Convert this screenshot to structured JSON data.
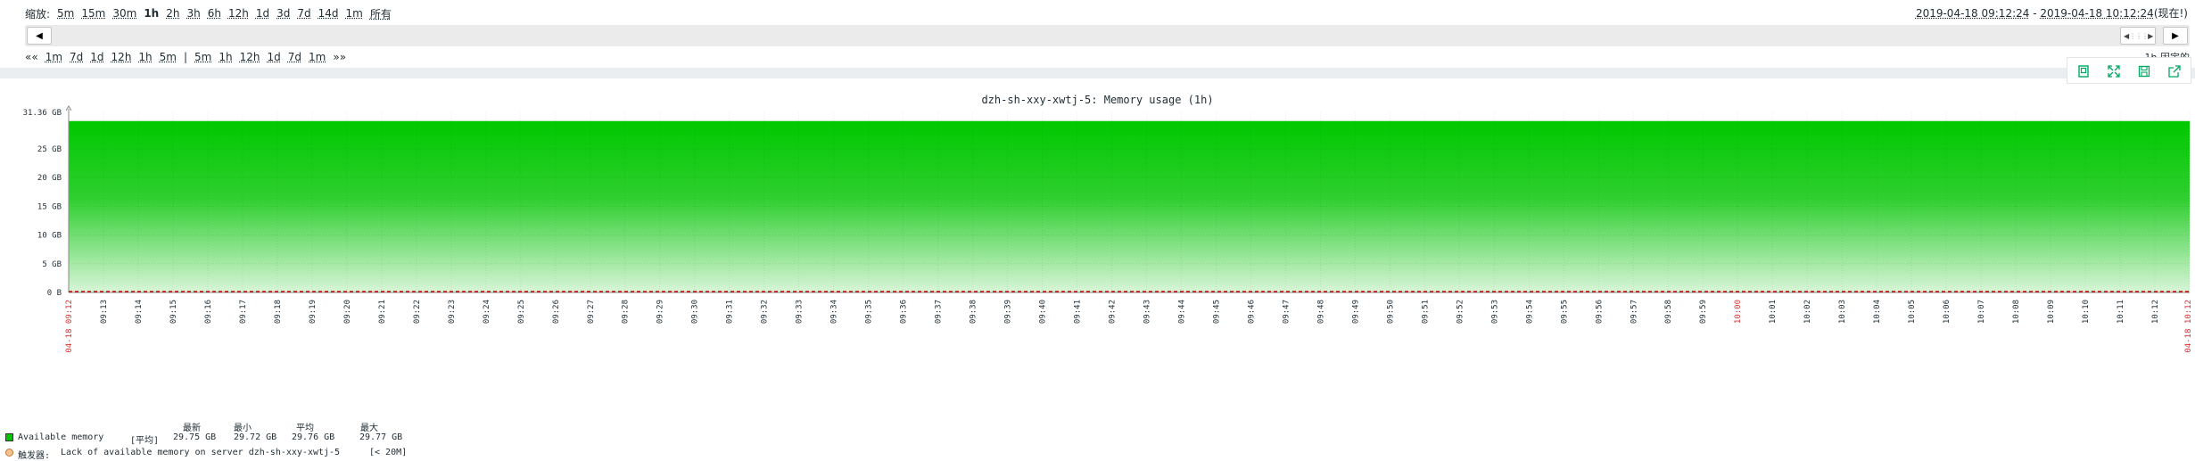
{
  "zoom": {
    "label": "缩放:",
    "options": [
      "5m",
      "15m",
      "30m",
      "1h",
      "2h",
      "3h",
      "6h",
      "12h",
      "1d",
      "3d",
      "7d",
      "14d",
      "1m",
      "所有"
    ],
    "active": "1h"
  },
  "period": {
    "from": "2019-04-18 09:12:24",
    "separator": " - ",
    "to": "2019-04-18 10:12:24",
    "now_label": "(现在!)"
  },
  "timeline": {
    "left_arrow": "◀",
    "right_arrow": "▶",
    "handle_left": "◀",
    "handle_right": "▶",
    "handle_grip": "⋮⋮⋮"
  },
  "nav": {
    "back_label": "««",
    "back_links": [
      "1m",
      "7d",
      "1d",
      "12h",
      "1h",
      "5m"
    ],
    "separator": "|",
    "forward_links": [
      "5m",
      "1h",
      "12h",
      "1d",
      "7d",
      "1m"
    ],
    "forward_label": "»»"
  },
  "fixed_label": "1h  固定的",
  "actions": [
    {
      "name": "add-to-favourites",
      "icon": "bookmark-icon"
    },
    {
      "name": "fullscreen",
      "icon": "expand-icon"
    },
    {
      "name": "save-image",
      "icon": "save-icon"
    },
    {
      "name": "export",
      "icon": "share-icon"
    }
  ],
  "accent_color": "#00a862",
  "chart_data": {
    "type": "area",
    "title": "dzh-sh-xxy-xwtj-5: Memory usage (1h)",
    "y_max_label": "31.36 GB",
    "y_ticks": [
      "25 GB",
      "20 GB",
      "15 GB",
      "10 GB",
      "5 GB",
      "0 B"
    ],
    "y_tick_values": [
      25,
      20,
      15,
      10,
      5,
      0
    ],
    "ylim": [
      0,
      31.36
    ],
    "x_start_label": "04-18 09:12",
    "x_end_label": "04-18 10:12",
    "x_ticks": [
      "09:13",
      "09:14",
      "09:15",
      "09:16",
      "09:17",
      "09:18",
      "09:19",
      "09:20",
      "09:21",
      "09:22",
      "09:23",
      "09:24",
      "09:25",
      "09:26",
      "09:27",
      "09:28",
      "09:29",
      "09:30",
      "09:31",
      "09:32",
      "09:33",
      "09:34",
      "09:35",
      "09:36",
      "09:37",
      "09:38",
      "09:39",
      "09:40",
      "09:41",
      "09:42",
      "09:43",
      "09:44",
      "09:45",
      "09:46",
      "09:47",
      "09:48",
      "09:49",
      "09:50",
      "09:51",
      "09:52",
      "09:53",
      "09:54",
      "09:55",
      "09:56",
      "09:57",
      "09:58",
      "09:59",
      "10:00",
      "10:01",
      "10:02",
      "10:03",
      "10:04",
      "10:05",
      "10:06",
      "10:07",
      "10:08",
      "10:09",
      "10:10",
      "10:11",
      "10:12"
    ],
    "x_highlight": [
      "10:00"
    ],
    "series": [
      {
        "name": "Available memory",
        "color": "#00c800",
        "value_gb": 29.76
      }
    ],
    "trigger_value_gb": 0,
    "trigger_color": "#c80000"
  },
  "legend": {
    "headers": [
      "最新",
      "最小",
      "平均",
      "最大"
    ],
    "rows": [
      {
        "label": "Available memory",
        "func": "[平均]",
        "last": "29.75 GB",
        "min": "29.72 GB",
        "avg": "29.76 GB",
        "max": "29.77 GB"
      }
    ],
    "trigger": {
      "prefix": "触发器:",
      "text": "Lack of available memory on server dzh-sh-xxy-xwtj-5",
      "threshold": "[< 20M]"
    }
  }
}
